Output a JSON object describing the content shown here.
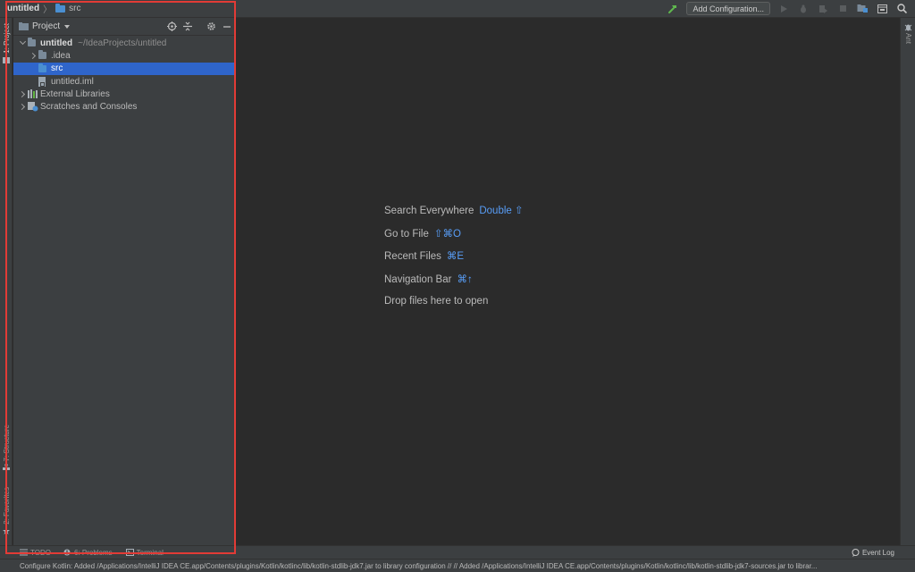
{
  "navbar": {
    "root": "untitled",
    "crumb": "src",
    "add_config_label": "Add Configuration..."
  },
  "left_stripe": {
    "project": "1: Project",
    "structure": "7: Structure",
    "favorites": "2: Favorites"
  },
  "project_panel": {
    "title": "Project",
    "tree": {
      "root_name": "untitled",
      "root_path": "~/IdeaProjects/untitled",
      "idea": ".idea",
      "src": "src",
      "iml": "untitled.iml",
      "external": "External Libraries",
      "scratches": "Scratches and Consoles"
    }
  },
  "editor": {
    "search_label": "Search Everywhere",
    "search_key": "Double ⇧",
    "goto_label": "Go to File",
    "goto_key": "⇧⌘O",
    "recent_label": "Recent Files",
    "recent_key": "⌘E",
    "nav_label": "Navigation Bar",
    "nav_key": "⌘↑",
    "drop_label": "Drop files here to open"
  },
  "right_stripe": {
    "ant": "Ant"
  },
  "bottom_bar": {
    "todo": "TODO",
    "problems": "6: Problems",
    "terminal": "Terminal",
    "event_log": "Event Log"
  },
  "status": {
    "message": "Configure Kotlin: Added /Applications/IntelliJ IDEA CE.app/Contents/plugins/Kotlin/kotlinc/lib/kotlin-stdlib-jdk7.jar to library configuration // // Added /Applications/IntelliJ IDEA CE.app/Contents/plugins/Kotlin/kotlinc/lib/kotlin-stdlib-jdk7-sources.jar to librar..."
  },
  "colors": {
    "accent_blue": "#589df6",
    "selection": "#2f65ca",
    "highlight_red": "#e23b36",
    "build_green": "#5fb84e"
  }
}
